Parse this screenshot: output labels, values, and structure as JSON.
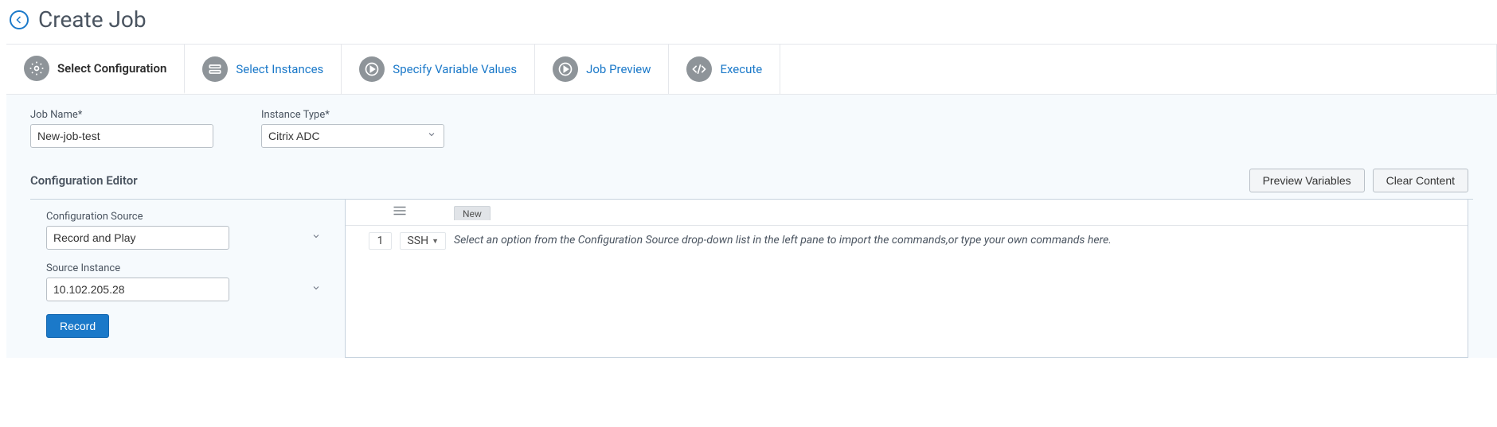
{
  "header": {
    "title": "Create Job"
  },
  "tabs": [
    {
      "label": "Select Configuration",
      "icon": "gear"
    },
    {
      "label": "Select Instances",
      "icon": "instances"
    },
    {
      "label": "Specify Variable Values",
      "icon": "play-circle"
    },
    {
      "label": "Job Preview",
      "icon": "play-circle"
    },
    {
      "label": "Execute",
      "icon": "code"
    }
  ],
  "form": {
    "job_name_label": "Job Name*",
    "job_name_value": "New-job-test",
    "instance_type_label": "Instance Type*",
    "instance_type_value": "Citrix ADC"
  },
  "editor": {
    "title": "Configuration Editor",
    "preview_btn": "Preview Variables",
    "clear_btn": "Clear Content",
    "config_source_label": "Configuration Source",
    "config_source_value": "Record and Play",
    "source_instance_label": "Source Instance",
    "source_instance_value": "10.102.205.28",
    "record_btn": "Record",
    "new_tab": "New",
    "lineno": "1",
    "protocol": "SSH",
    "placeholder": "Select an option from the Configuration Source drop-down list in the left pane to import the commands,or type your own commands here."
  }
}
